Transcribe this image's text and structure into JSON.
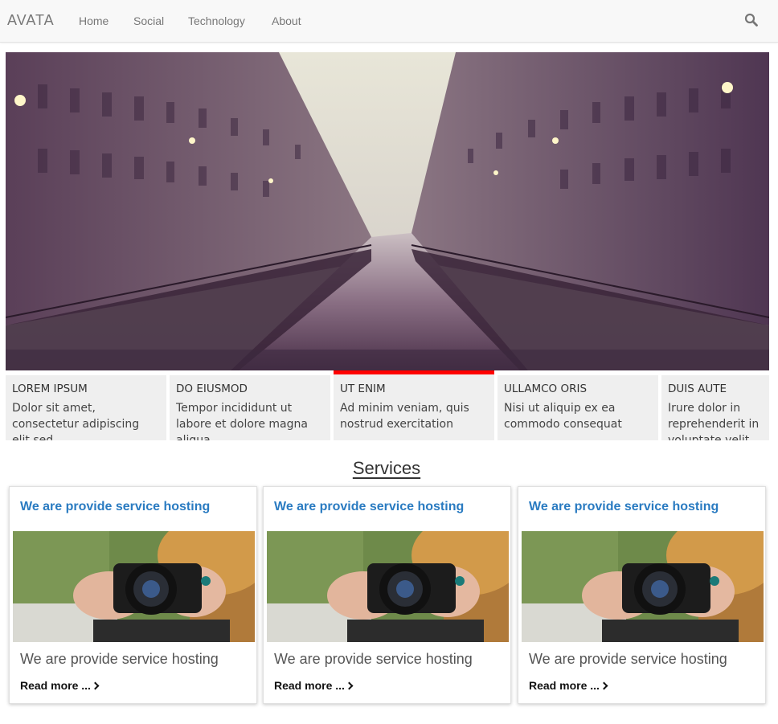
{
  "brand": "AVATA",
  "nav": {
    "home": "Home",
    "social": "Social",
    "technology": "Technology",
    "about": "About"
  },
  "icons": {
    "search": "search-icon",
    "read_more": "chevron-right-icon"
  },
  "colors": {
    "accent_red": "#ff0000",
    "link_blue": "#2a7bc1",
    "caption_bg": "#efefef"
  },
  "slider": {
    "image": "canal-city-evening-photo",
    "captions": [
      {
        "title": "LOREM IPSUM",
        "text": "Dolor sit amet, consectetur adipiscing elit sed"
      },
      {
        "title": "DO EIUSMOD",
        "text": "Tempor incididunt ut labore et dolore magna aliqua"
      },
      {
        "title": "UT ENIM",
        "text": "Ad minim veniam, quis nostrud exercitation"
      },
      {
        "title": "ULLAMCO ORIS",
        "text": "Nisi ut aliquip ex ea commodo consequat"
      },
      {
        "title": "DUIS AUTE",
        "text": "Irure dolor in reprehenderit in voluptate velit"
      }
    ],
    "active_index": 2
  },
  "services": {
    "title": "Services",
    "cards": [
      {
        "heading": "We are provide service hosting",
        "image": "hands-holding-camera-photo",
        "description": "We are provide service hosting",
        "read_more": "Read more ..."
      },
      {
        "heading": "We are provide service hosting",
        "image": "hands-holding-camera-photo",
        "description": "We are provide service hosting",
        "read_more": "Read more ..."
      },
      {
        "heading": "We are provide service hosting",
        "image": "hands-holding-camera-photo",
        "description": "We are provide service hosting",
        "read_more": "Read more ..."
      }
    ]
  }
}
